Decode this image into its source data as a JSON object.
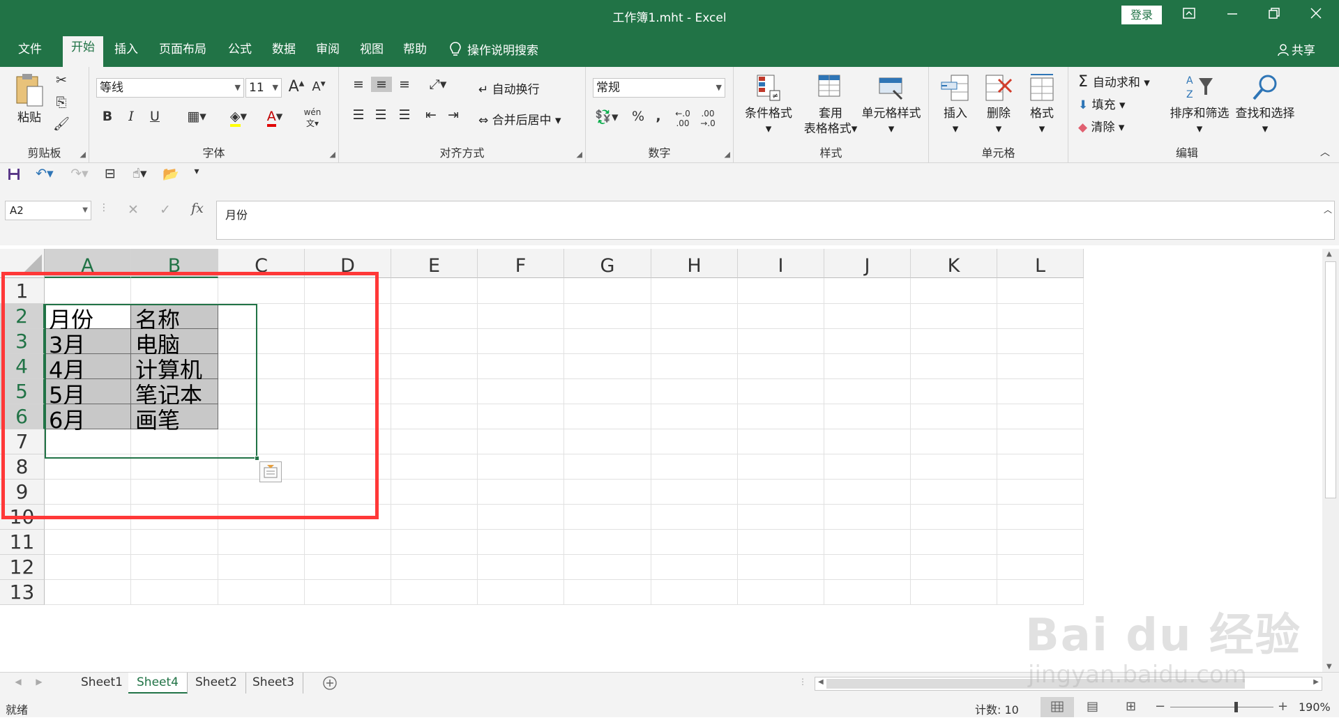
{
  "window": {
    "title": "工作簿1.mht  -  Excel",
    "login_label": "登录",
    "ribbon_display_icon": "ribbon-display-icon",
    "minimize_icon": "minimize-icon",
    "restore_icon": "restore-icon",
    "close_icon": "close-icon"
  },
  "menu": {
    "tabs": [
      "文件",
      "开始",
      "插入",
      "页面布局",
      "公式",
      "数据",
      "审阅",
      "视图",
      "帮助"
    ],
    "active_tab": "开始",
    "tell_me": "操作说明搜索",
    "share": "共享"
  },
  "ribbon": {
    "clipboard": {
      "label": "剪贴板",
      "paste": "粘贴"
    },
    "font": {
      "label": "字体",
      "font_name": "等线",
      "font_size": "11",
      "bold": "B",
      "italic": "I",
      "underline": "U",
      "phonetic": "wén"
    },
    "alignment": {
      "label": "对齐方式",
      "wrap_text": "自动换行",
      "merge_center": "合并后居中"
    },
    "number": {
      "label": "数字",
      "format": "常规",
      "percent": "%",
      "comma": ","
    },
    "styles": {
      "label": "样式",
      "conditional": "条件格式",
      "table_format_1": "套用",
      "table_format_2": "表格格式",
      "cell_styles": "单元格样式"
    },
    "cells": {
      "label": "单元格",
      "insert": "插入",
      "delete": "删除",
      "format": "格式"
    },
    "editing": {
      "label": "编辑",
      "autosum": "自动求和",
      "fill": "填充",
      "clear": "清除",
      "sort_filter": "排序和筛选",
      "find_select": "查找和选择"
    }
  },
  "formula_bar": {
    "name_box": "A2",
    "cancel": "✕",
    "enter": "✓",
    "fx": "fx",
    "content": "月份"
  },
  "sheet": {
    "columns": [
      "A",
      "B",
      "C",
      "D",
      "E",
      "F",
      "G",
      "H",
      "I",
      "J",
      "K",
      "L"
    ],
    "selected_columns": [
      "A",
      "B"
    ],
    "rows": [
      "1",
      "2",
      "3",
      "4",
      "5",
      "6",
      "7",
      "8",
      "9",
      "10",
      "11",
      "12",
      "13"
    ],
    "selected_rows": [
      "2",
      "3",
      "4",
      "5",
      "6"
    ],
    "cells": {
      "A2": "月份",
      "B2": "名称",
      "A3": "3月",
      "B3": "电脑",
      "A4": "4月",
      "B4": "计算机",
      "A5": "5月",
      "B5": "笔记本",
      "A6": "6月",
      "B6": "画笔"
    }
  },
  "sheet_tabs": {
    "tabs": [
      "Sheet1",
      "Sheet4",
      "Sheet2",
      "Sheet3"
    ],
    "active": "Sheet4"
  },
  "status": {
    "ready": "就绪",
    "count": "计数: 10",
    "zoom": "190%"
  },
  "watermark": {
    "brand": "Bai du 经验",
    "url": "jingyan.baidu.com"
  },
  "colors": {
    "accent": "#217346",
    "highlight_box": "#ff3838",
    "selection_fill": "#c8c8c8"
  }
}
